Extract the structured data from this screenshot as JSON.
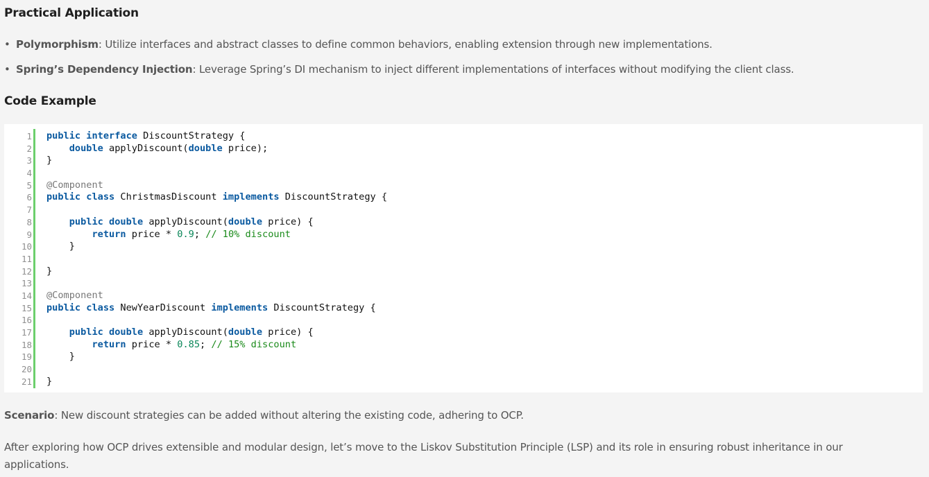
{
  "headings": {
    "practical": "Practical Application",
    "code_example": "Code Example"
  },
  "bullets": [
    {
      "term": "Polymorphism",
      "text": ": Utilize interfaces and abstract classes to define common behaviors, enabling extension through new implementations."
    },
    {
      "term": "Spring’s Dependency Injection",
      "text": ": Leverage Spring’s DI mechanism to inject different implementations of interfaces without modifying the client class."
    }
  ],
  "code": {
    "line_numbers": [
      "1",
      "2",
      "3",
      "4",
      "5",
      "6",
      "7",
      "8",
      "9",
      "10",
      "11",
      "12",
      "13",
      "14",
      "15",
      "16",
      "17",
      "18",
      "19",
      "20",
      "21"
    ],
    "lines": [
      [
        {
          "t": "public interface",
          "c": "kw"
        },
        {
          "t": " DiscountStrategy {",
          "c": ""
        }
      ],
      [
        {
          "t": "    ",
          "c": ""
        },
        {
          "t": "double",
          "c": "kw"
        },
        {
          "t": " applyDiscount(",
          "c": ""
        },
        {
          "t": "double",
          "c": "kw"
        },
        {
          "t": " price);",
          "c": ""
        }
      ],
      [
        {
          "t": "}",
          "c": ""
        }
      ],
      [],
      [
        {
          "t": "@Component",
          "c": "ann"
        }
      ],
      [
        {
          "t": "public class",
          "c": "kw"
        },
        {
          "t": " ChristmasDiscount ",
          "c": ""
        },
        {
          "t": "implements",
          "c": "kw"
        },
        {
          "t": " DiscountStrategy {",
          "c": ""
        }
      ],
      [],
      [
        {
          "t": "    ",
          "c": ""
        },
        {
          "t": "public double",
          "c": "kw"
        },
        {
          "t": " applyDiscount(",
          "c": ""
        },
        {
          "t": "double",
          "c": "kw"
        },
        {
          "t": " price) {",
          "c": ""
        }
      ],
      [
        {
          "t": "        ",
          "c": ""
        },
        {
          "t": "return",
          "c": "kw"
        },
        {
          "t": " price * ",
          "c": ""
        },
        {
          "t": "0.9",
          "c": "num"
        },
        {
          "t": "; ",
          "c": ""
        },
        {
          "t": "// 10% discount",
          "c": "cmt"
        }
      ],
      [
        {
          "t": "    }",
          "c": ""
        }
      ],
      [],
      [
        {
          "t": "}",
          "c": ""
        }
      ],
      [],
      [
        {
          "t": "@Component",
          "c": "ann"
        }
      ],
      [
        {
          "t": "public class",
          "c": "kw"
        },
        {
          "t": " NewYearDiscount ",
          "c": ""
        },
        {
          "t": "implements",
          "c": "kw"
        },
        {
          "t": " DiscountStrategy {",
          "c": ""
        }
      ],
      [],
      [
        {
          "t": "    ",
          "c": ""
        },
        {
          "t": "public double",
          "c": "kw"
        },
        {
          "t": " applyDiscount(",
          "c": ""
        },
        {
          "t": "double",
          "c": "kw"
        },
        {
          "t": " price) {",
          "c": ""
        }
      ],
      [
        {
          "t": "        ",
          "c": ""
        },
        {
          "t": "return",
          "c": "kw"
        },
        {
          "t": " price * ",
          "c": ""
        },
        {
          "t": "0.85",
          "c": "num"
        },
        {
          "t": "; ",
          "c": ""
        },
        {
          "t": "// 15% discount",
          "c": "cmt"
        }
      ],
      [
        {
          "t": "    }",
          "c": ""
        }
      ],
      [],
      [
        {
          "t": "}",
          "c": ""
        }
      ]
    ]
  },
  "scenario": {
    "term": "Scenario",
    "text": ": New discount strategies can be added without altering the existing code, adhering to OCP."
  },
  "closing": "After exploring how OCP drives extensible and modular design, let’s move to the Liskov Substitution Principle (LSP) and its role in ensuring robust inheritance in our applications."
}
